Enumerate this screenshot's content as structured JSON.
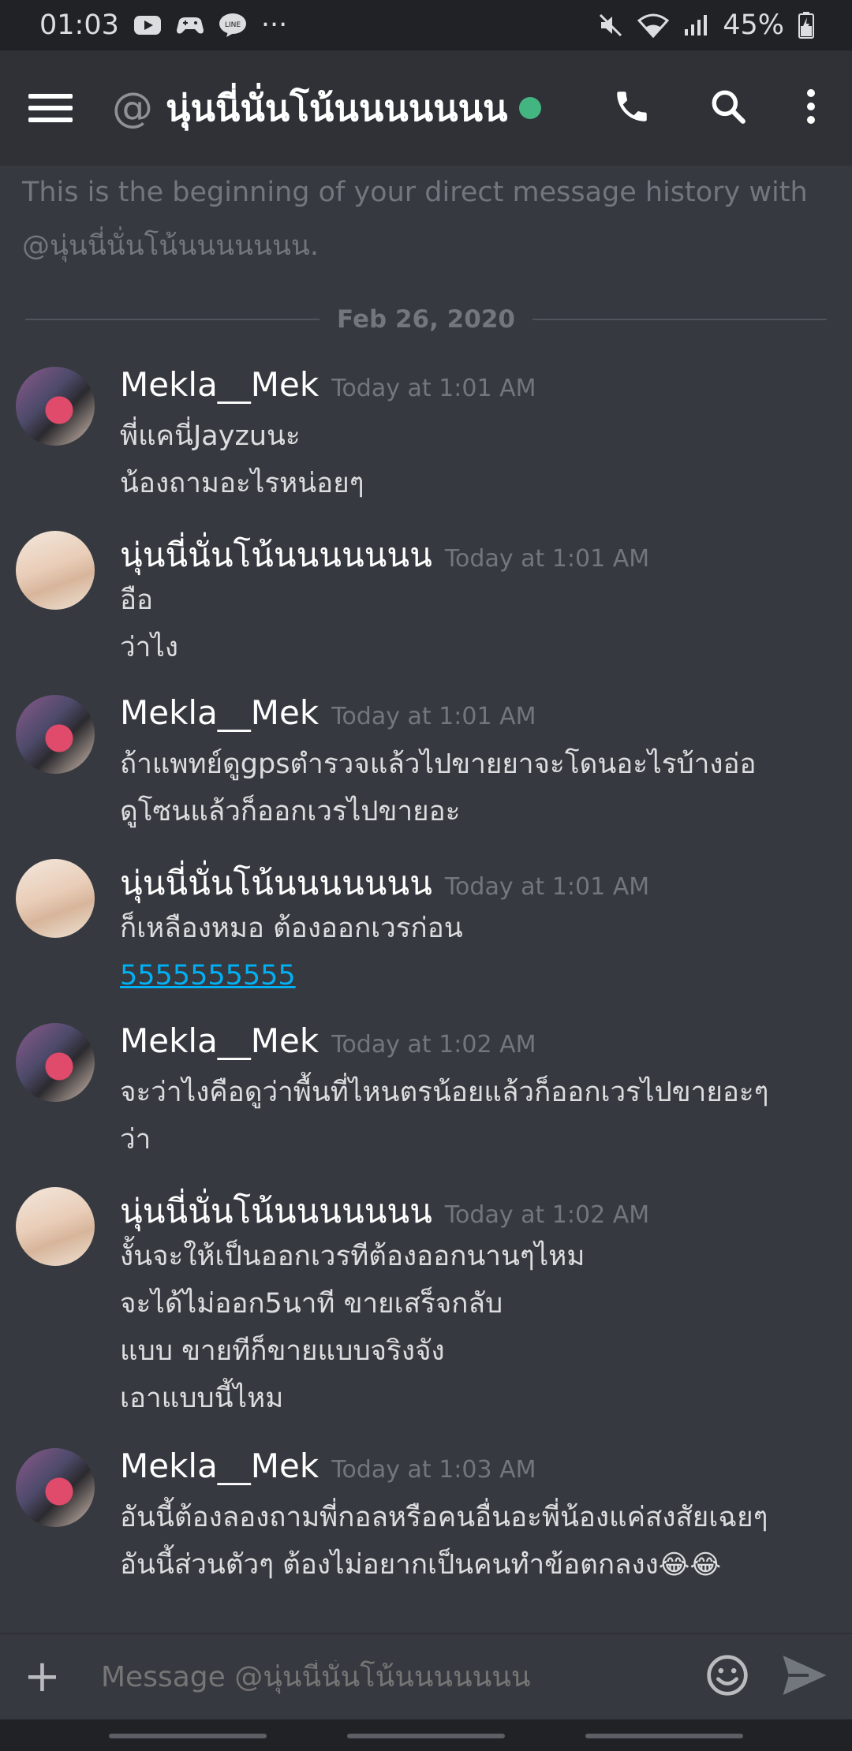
{
  "status_bar": {
    "time": "01:03",
    "battery": "45%",
    "ellipsis": "···"
  },
  "header": {
    "at_symbol": "@",
    "title": "นุ่นนี่นั่นโน้นนนนนนน"
  },
  "intro": {
    "line1": "This is the beginning of your direct message history with",
    "line2": "@นุ่นนี่นั่นโน้นนนนนนน."
  },
  "divider_date": "Feb 26, 2020",
  "messages": [
    {
      "author": "Mekla__Mek",
      "time": "Today at 1:01 AM",
      "lines": [
        "พี่แคนี่Jayzuนะ",
        "น้องถามอะไรหน่อยๆ"
      ]
    },
    {
      "author": "นุ่นนี่นั่นโน้นนนนนนน",
      "time": "Today at 1:01 AM",
      "lines": [
        "อือ",
        "ว่าไง"
      ]
    },
    {
      "author": "Mekla__Mek",
      "time": "Today at 1:01 AM",
      "lines": [
        "ถ้าแพทย์ดูgpsตำรวจแล้วไปขายยาจะโดนอะไรบ้างอ่อ",
        "ดูโซนแล้วก็ออกเวรไปขายอะ"
      ]
    },
    {
      "author": "นุ่นนี่นั่นโน้นนนนนนน",
      "time": "Today at 1:01 AM",
      "lines": [
        "ก็เหลืองหมอ ต้องออกเวรก่อน",
        "5555555555"
      ]
    },
    {
      "author": "Mekla__Mek",
      "time": "Today at 1:02 AM",
      "lines": [
        "จะว่าไงคือดูว่าพื้นที่ไหนตรน้อยแล้วก็ออกเวรไปขายอะๆ",
        "ว่า"
      ]
    },
    {
      "author": "นุ่นนี่นั่นโน้นนนนนนน",
      "time": "Today at 1:02 AM",
      "lines": [
        "งั้นจะให้เป็นออกเวรทีต้องออกนานๆไหม",
        "จะได้ไม่ออก5นาที ขายเสร็จกลับ",
        "แบบ ขายทีก็ขายแบบจริงจัง",
        "เอาแบบนี้ไหม"
      ]
    },
    {
      "author": "Mekla__Mek",
      "time": "Today at 1:03 AM",
      "lines": [
        "อันนี้ต้องลองถามพี่กอลหรือคนอื่นอะพี่น้องแค่สงสัยเฉยๆ",
        "อันนี้ส่วนตัวๆ ต้องไม่อยากเป็นคนทำข้อตกลงง"
      ],
      "emoji": "😂😂"
    }
  ],
  "composer": {
    "placeholder": "Message @นุ่นนี่นั่นโน้นนนนนนน"
  },
  "colors": {
    "background": "#36393f",
    "header": "#2f3136",
    "online": "#43b581",
    "link": "#00b0f4"
  }
}
